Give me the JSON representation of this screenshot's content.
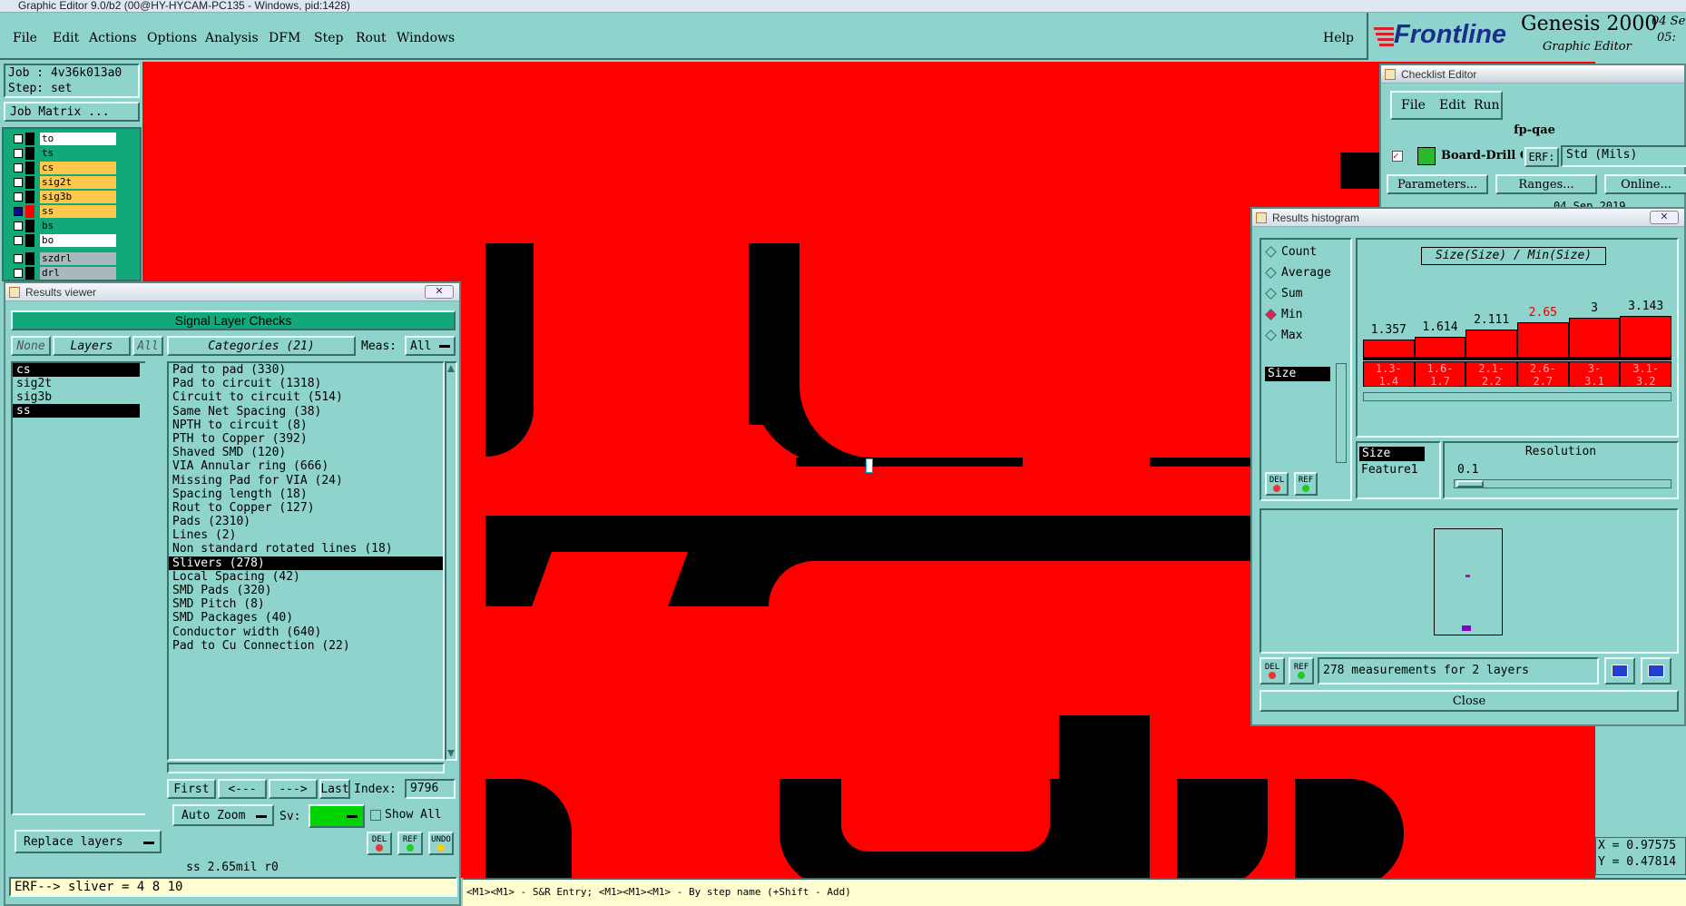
{
  "window_title": "Graphic Editor 9.0/b2 (00@HY-HYCAM-PC135 - Windows, pid:1428)",
  "menu": [
    "File",
    "Edit",
    "Actions",
    "Options",
    "Analysis",
    "DFM",
    "Step",
    "Rout",
    "Windows"
  ],
  "help": "Help",
  "brand": {
    "logo": "Frontline",
    "product": "Genesis 2000",
    "subtitle": "Graphic Editor",
    "date_top": "04 Se",
    "date_bottom": "05:"
  },
  "job": {
    "job_line": "Job : 4v36k013a0",
    "step_line": "Step: set",
    "matrix_button": "Job Matrix ..."
  },
  "layers": [
    {
      "name": "to",
      "color": "#ffffff",
      "selected": false
    },
    {
      "name": "ts",
      "color": "#13a87a",
      "selected": false
    },
    {
      "name": "cs",
      "color": "#ffc84a",
      "selected": false
    },
    {
      "name": "sig2t",
      "color": "#ffc84a",
      "selected": false
    },
    {
      "name": "sig3b",
      "color": "#ffc84a",
      "selected": false
    },
    {
      "name": "ss",
      "color": "#ffc84a",
      "selected": true
    },
    {
      "name": "bs",
      "color": "#13a87a",
      "selected": false
    },
    {
      "name": "bo",
      "color": "#ffffff",
      "selected": false
    },
    {
      "name": "szdrl",
      "color": "#a8b8bc",
      "selected": false
    },
    {
      "name": "drl",
      "color": "#a8b8bc",
      "selected": false
    }
  ],
  "results_viewer": {
    "title": "Results viewer",
    "close": "✕",
    "header": "Signal Layer Checks",
    "btn_none": "None",
    "btn_layers": "Layers",
    "btn_all": "All",
    "categories_btn": "Categories (21)",
    "meas_label": "Meas:",
    "meas_value": "All",
    "layer_list": [
      {
        "name": "cs",
        "selected": true
      },
      {
        "name": "sig2t",
        "selected": false
      },
      {
        "name": "sig3b",
        "selected": false
      },
      {
        "name": "ss",
        "selected": true
      }
    ],
    "categories": [
      {
        "label": "Pad to pad (330)",
        "selected": false
      },
      {
        "label": "Pad to circuit (1318)",
        "selected": false
      },
      {
        "label": "Circuit to circuit (514)",
        "selected": false
      },
      {
        "label": "Same Net Spacing (38)",
        "selected": false
      },
      {
        "label": "NPTH to circuit (8)",
        "selected": false
      },
      {
        "label": "PTH to Copper (392)",
        "selected": false
      },
      {
        "label": "Shaved SMD (120)",
        "selected": false
      },
      {
        "label": "VIA Annular ring (666)",
        "selected": false
      },
      {
        "label": "Missing Pad for VIA (24)",
        "selected": false
      },
      {
        "label": "Spacing length (18)",
        "selected": false
      },
      {
        "label": "Rout to Copper (127)",
        "selected": false
      },
      {
        "label": "Pads (2310)",
        "selected": false
      },
      {
        "label": "Lines (2)",
        "selected": false
      },
      {
        "label": "Non standard rotated lines (18)",
        "selected": false
      },
      {
        "label": "Slivers (278)",
        "selected": true
      },
      {
        "label": "Local Spacing (42)",
        "selected": false
      },
      {
        "label": "SMD Pads (320)",
        "selected": false
      },
      {
        "label": "SMD Pitch (8)",
        "selected": false
      },
      {
        "label": "SMD Packages (40)",
        "selected": false
      },
      {
        "label": "Conductor width (640)",
        "selected": false
      },
      {
        "label": "Pad to Cu Connection (22)",
        "selected": false
      }
    ],
    "nav": {
      "first": "First",
      "prev": "<---",
      "next": "--->",
      "last": "Last",
      "index_label": "Index:",
      "index_value": "9796"
    },
    "auto_zoom": "Auto Zoom",
    "sv_label": "Sv:",
    "show_all": "Show All",
    "replace_layers": "Replace layers",
    "del": "DEL",
    "ref": "REF",
    "undo": "UNDO",
    "status_line": "ss 2.65mil  r0",
    "erf_line": "ERF--> sliver = 4 8 10"
  },
  "checklist_editor": {
    "title": "Checklist Editor",
    "menu": [
      "File",
      "Edit",
      "Run"
    ],
    "name": "fp-qae",
    "board_drill": "Board-Drill Che",
    "erf_label": "ERF:",
    "erf_value": "Std (Mils)",
    "parameters": "Parameters...",
    "ranges": "Ranges...",
    "online": "Online...",
    "date": "04 Sep 2019"
  },
  "histogram": {
    "title": "Results histogram",
    "close": "✕",
    "modes": [
      {
        "label": "Count",
        "active": false
      },
      {
        "label": "Average",
        "active": false
      },
      {
        "label": "Sum",
        "active": false
      },
      {
        "label": "Min",
        "active": true
      },
      {
        "label": "Max",
        "active": false
      }
    ],
    "size_item": "Size",
    "chart_title": "Size(Size) / Min(Size)",
    "bins": [
      {
        "value": "1.357",
        "range": "1.3-\n1.4",
        "level": 0.43,
        "highlight": false
      },
      {
        "value": "1.614",
        "range": "1.6-\n1.7",
        "level": 0.51,
        "highlight": false
      },
      {
        "value": "2.111",
        "range": "2.1-\n2.2",
        "level": 0.67,
        "highlight": false
      },
      {
        "value": "2.65",
        "range": "2.6-\n2.7",
        "level": 0.84,
        "highlight": true
      },
      {
        "value": "3",
        "range": "3-\n3.1",
        "level": 0.95,
        "highlight": false
      },
      {
        "value": "3.143",
        "range": "3.1-\n3.2",
        "level": 1.0,
        "highlight": false
      }
    ],
    "size_label": "Size",
    "feature_label": "Feature1",
    "resolution_label": "Resolution",
    "resolution_value": "0.1",
    "measurements": "278 measurements for 2 layers",
    "close_button": "Close",
    "del": "DEL",
    "ref": "REF"
  },
  "coords": {
    "x": "X = 0.97575",
    "y": "Y = 0.47814"
  },
  "status_bar": "<M1><M1> - S&R Entry; <M1><M1><M1> - By step name (+Shift - Add)",
  "colors": {
    "panel": "#8ed4cc",
    "canvas": "#ff0000",
    "copper": "#000000",
    "accent_green": "#00d400",
    "status_bg": "#fffed0"
  }
}
